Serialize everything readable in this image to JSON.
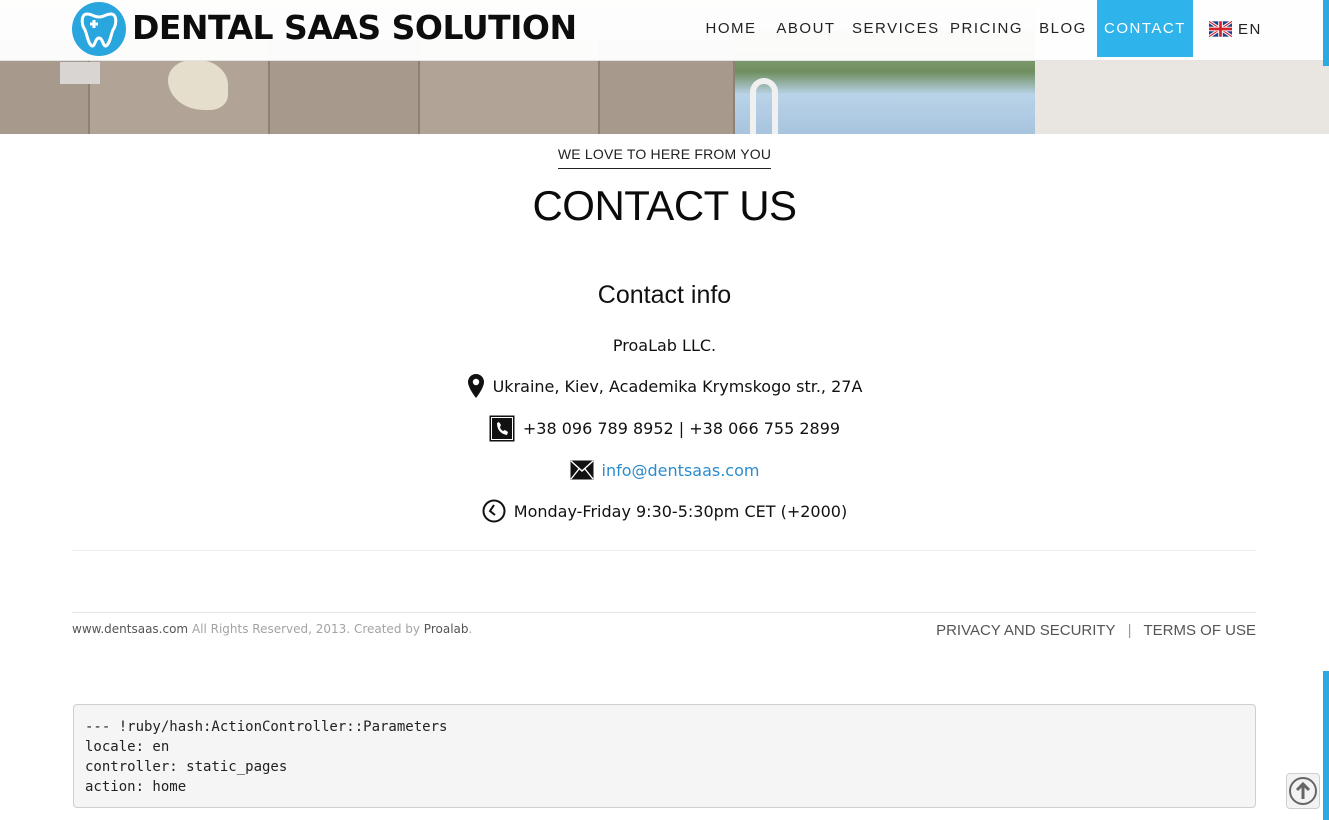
{
  "brand": {
    "name": "DENTAL SAAS SOLUTION",
    "logo_icon": "tooth-plus-icon"
  },
  "nav": {
    "items": [
      {
        "label": "HOME"
      },
      {
        "label": "ABOUT"
      },
      {
        "label": "SERVICES"
      },
      {
        "label": "PRICING"
      },
      {
        "label": "BLOG"
      },
      {
        "label": "CONTACT",
        "active": true
      }
    ],
    "language": {
      "label": "EN",
      "flag_icon": "uk-flag-icon"
    }
  },
  "page": {
    "eyebrow": "WE LOVE TO HERE FROM YOU",
    "title": "CONTACT US",
    "section_title": "Contact info",
    "company": "ProaLab LLC.",
    "address": "Ukraine, Kiev, Academika Krymskogo str., 27A",
    "phones": "+38 096 789 8952 | +38 066 755 2899",
    "email": "info@dentsaas.com",
    "hours": "Monday-Friday 9:30-5:30pm CET (+2000)"
  },
  "footer": {
    "site": "www.dentsaas.com",
    "rights": " All Rights Reserved, 2013. Created by ",
    "creator": "Proalab",
    "period": ".",
    "links": [
      "PRIVACY AND SECURITY",
      "TERMS OF USE"
    ],
    "separator": "|"
  },
  "debug_lines": [
    "--- !ruby/hash:ActionController::Parameters",
    "locale: en",
    "controller: static_pages",
    "action: home"
  ],
  "colors": {
    "accent": "#2eb4ea",
    "link": "#2a8ccf"
  }
}
